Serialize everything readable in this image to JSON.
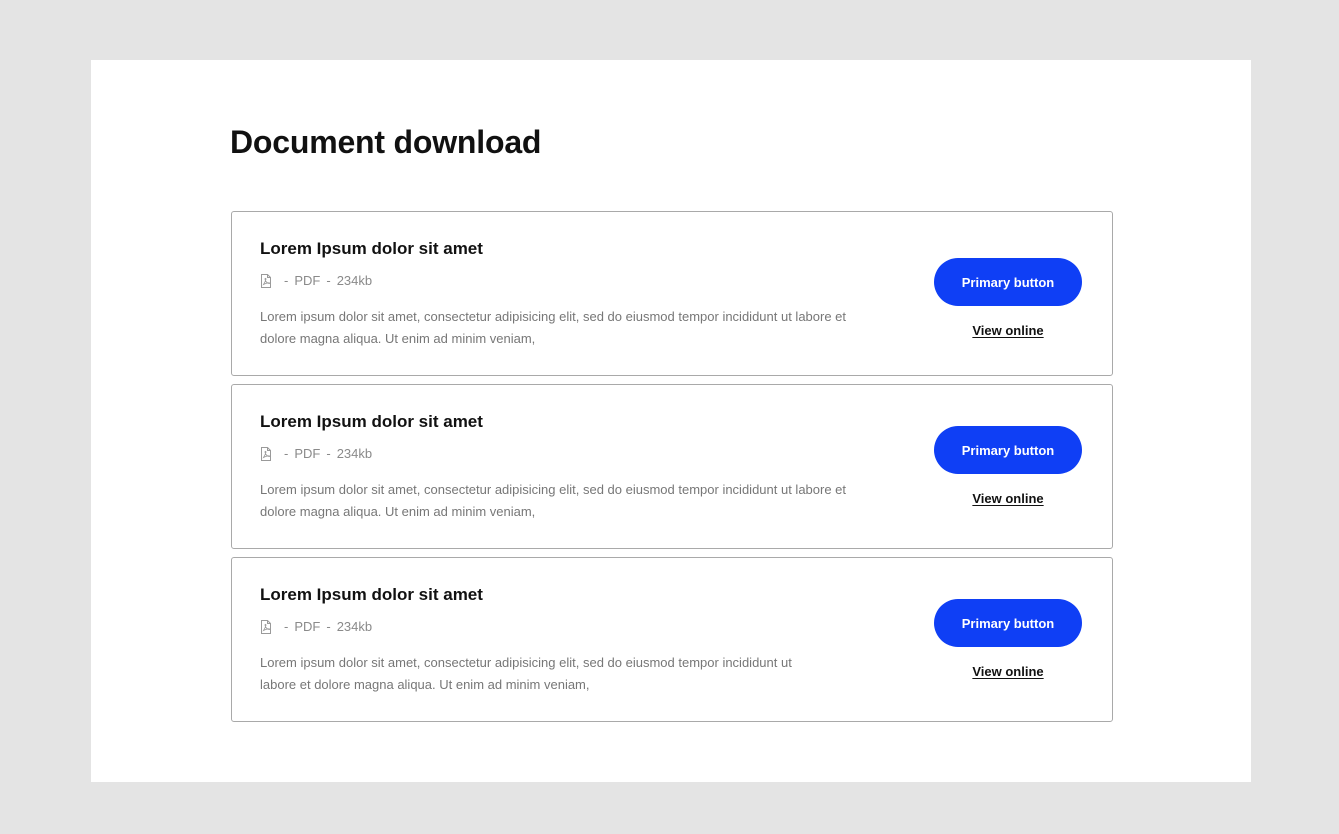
{
  "page": {
    "title": "Document download"
  },
  "documents": [
    {
      "title": "Lorem Ipsum dolor sit amet",
      "file_type": "PDF",
      "file_size": "234kb",
      "description": "Lorem ipsum dolor sit amet, consectetur adipisicing elit, sed do eiusmod tempor incididunt ut labore et dolore magna aliqua. Ut enim ad minim veniam,",
      "primary_label": "Primary button",
      "link_label": "View online"
    },
    {
      "title": "Lorem Ipsum dolor sit amet",
      "file_type": "PDF",
      "file_size": "234kb",
      "description": "Lorem ipsum dolor sit amet, consectetur adipisicing elit, sed do eiusmod tempor incididunt ut labore et dolore magna aliqua. Ut enim ad minim veniam,",
      "primary_label": "Primary button",
      "link_label": "View online"
    },
    {
      "title": "Lorem Ipsum dolor sit amet",
      "file_type": "PDF",
      "file_size": "234kb",
      "description": "Lorem ipsum dolor sit amet, consectetur adipisicing elit, sed do eiusmod tempor incididunt ut labore et dolore magna aliqua. Ut enim ad minim veniam,",
      "primary_label": "Primary button",
      "link_label": "View online"
    }
  ],
  "icons": {
    "file": "pdf-file-icon"
  },
  "colors": {
    "page_background": "#e4e4e4",
    "panel_background": "#ffffff",
    "primary_button": "#0f3ff5",
    "card_border": "#a9a9a9",
    "muted_text": "#8a8a8a"
  }
}
